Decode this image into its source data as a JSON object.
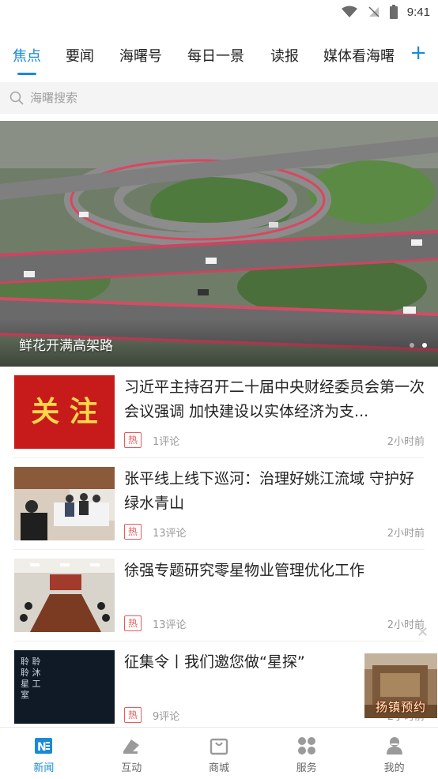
{
  "status_bar": {
    "time": "9:41"
  },
  "tabs": [
    {
      "label": "焦点",
      "active": true
    },
    {
      "label": "要闻"
    },
    {
      "label": "海曙号"
    },
    {
      "label": "每日一景"
    },
    {
      "label": "读报"
    },
    {
      "label": "媒体看海曙"
    }
  ],
  "tab_add": "+",
  "search": {
    "placeholder": "海曙搜索"
  },
  "banner": {
    "caption": "鲜花开满高架路"
  },
  "news": [
    {
      "thumb_text": "关 注",
      "title": "习近平主持召开二十届中央财经委员会第一次会议强调 加快建设以实体经济为支...",
      "hot": "热",
      "comments": "1评论",
      "time": "2小时前"
    },
    {
      "title": "张平线上线下巡河：治理好姚江流域 守护好绿水青山",
      "hot": "热",
      "comments": "13评论",
      "time": "2小时前"
    },
    {
      "title": "徐强专题研究零星物业管理优化工作",
      "hot": "热",
      "comments": "13评论",
      "time": "2小时前"
    },
    {
      "thumb_text": "聆 聆 聆 沐 星 工 室",
      "title": "征集令丨我们邀您做“星探”",
      "hot": "热",
      "comments": "9评论",
      "time": "2小时前"
    }
  ],
  "float_ad": {
    "text": "扬镇预约"
  },
  "bottom_nav": [
    {
      "label": "新闻",
      "active": true
    },
    {
      "label": "互动"
    },
    {
      "label": "商城"
    },
    {
      "label": "服务"
    },
    {
      "label": "我的"
    }
  ],
  "colors": {
    "accent": "#1a8ad6",
    "hot": "#e75a5a"
  }
}
